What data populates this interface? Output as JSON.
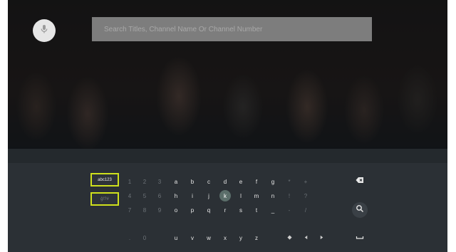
{
  "search": {
    "placeholder": "Search Titles, Channel Name Or Channel Number",
    "value": ""
  },
  "keyboard": {
    "mode_keys": [
      "abc123",
      "ĝ!?#"
    ],
    "rows": [
      [
        "1",
        "2",
        "3",
        "a",
        "b",
        "c",
        "d",
        "e",
        "f",
        "g",
        "*",
        "+"
      ],
      [
        "4",
        "5",
        "6",
        "h",
        "i",
        "j",
        "k",
        "l",
        "m",
        "n",
        "!",
        "?"
      ],
      [
        "7",
        "8",
        "9",
        "o",
        "p",
        "q",
        "r",
        "s",
        "t",
        "_",
        "-",
        "/"
      ],
      [
        ".",
        "0",
        "",
        "u",
        "v",
        "w",
        "x",
        "y",
        "z",
        "",
        "",
        ""
      ]
    ],
    "focused_key": "k",
    "action_icons": [
      "backspace-icon",
      "search-icon",
      "space-icon"
    ]
  },
  "colors": {
    "focus_outline": "#cfe01c",
    "focused_key": "#5b6e6a",
    "keyboard_background": "#2b3035"
  }
}
